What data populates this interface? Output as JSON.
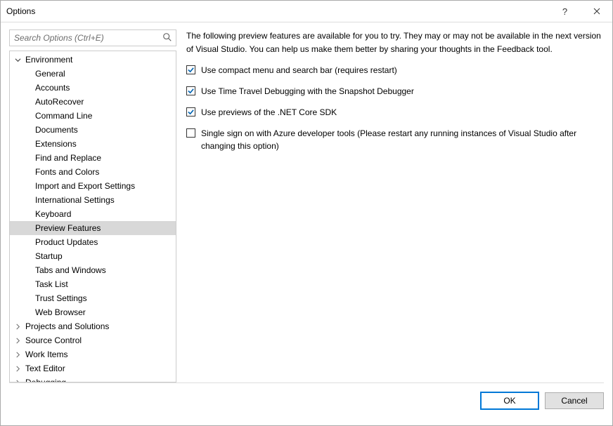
{
  "window": {
    "title": "Options"
  },
  "search": {
    "placeholder": "Search Options (Ctrl+E)"
  },
  "tree": {
    "nodes": [
      {
        "label": "Environment",
        "depth": 1,
        "expander": "down"
      },
      {
        "label": "General",
        "depth": 2
      },
      {
        "label": "Accounts",
        "depth": 2
      },
      {
        "label": "AutoRecover",
        "depth": 2
      },
      {
        "label": "Command Line",
        "depth": 2
      },
      {
        "label": "Documents",
        "depth": 2
      },
      {
        "label": "Extensions",
        "depth": 2
      },
      {
        "label": "Find and Replace",
        "depth": 2
      },
      {
        "label": "Fonts and Colors",
        "depth": 2
      },
      {
        "label": "Import and Export Settings",
        "depth": 2
      },
      {
        "label": "International Settings",
        "depth": 2
      },
      {
        "label": "Keyboard",
        "depth": 2
      },
      {
        "label": "Preview Features",
        "depth": 2,
        "selected": true
      },
      {
        "label": "Product Updates",
        "depth": 2
      },
      {
        "label": "Startup",
        "depth": 2
      },
      {
        "label": "Tabs and Windows",
        "depth": 2
      },
      {
        "label": "Task List",
        "depth": 2
      },
      {
        "label": "Trust Settings",
        "depth": 2
      },
      {
        "label": "Web Browser",
        "depth": 2
      },
      {
        "label": "Projects and Solutions",
        "depth": 1,
        "expander": "right"
      },
      {
        "label": "Source Control",
        "depth": 1,
        "expander": "right"
      },
      {
        "label": "Work Items",
        "depth": 1,
        "expander": "right"
      },
      {
        "label": "Text Editor",
        "depth": 1,
        "expander": "right"
      },
      {
        "label": "Debugging",
        "depth": 1,
        "expander": "right",
        "dashed": true
      }
    ]
  },
  "content": {
    "intro": "The following preview features are available for you to try. They may or may not be available in the next version of Visual Studio. You can help us make them better by sharing your thoughts in the Feedback tool.",
    "options": [
      {
        "label": "Use compact menu and search bar (requires restart)",
        "checked": true
      },
      {
        "label": "Use Time Travel Debugging with the Snapshot Debugger",
        "checked": true
      },
      {
        "label": "Use previews of the .NET Core SDK",
        "checked": true
      },
      {
        "label": "Single sign on with Azure developer tools (Please restart any running instances of Visual Studio after changing this option)",
        "checked": false
      }
    ]
  },
  "buttons": {
    "ok": "OK",
    "cancel": "Cancel"
  }
}
